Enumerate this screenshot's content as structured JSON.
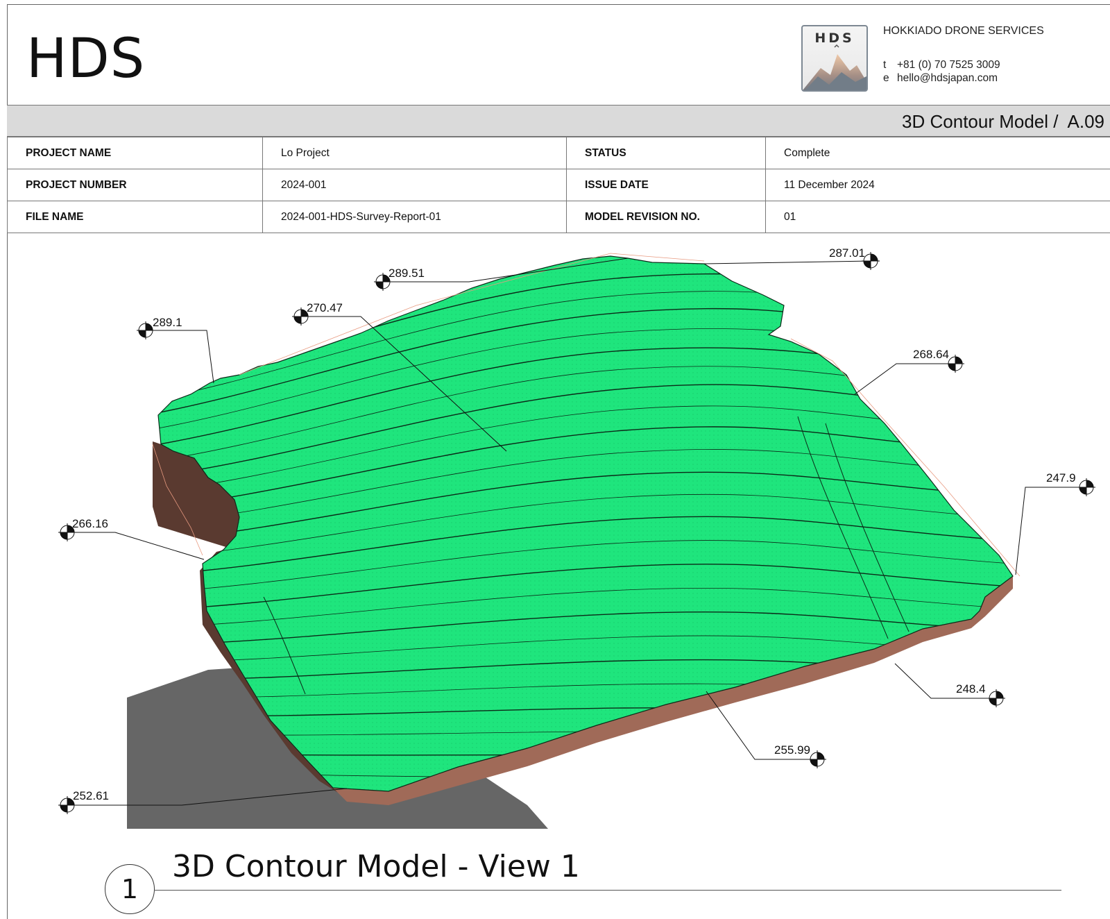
{
  "header": {
    "brand": "HDS",
    "logo_text": "HDS",
    "company": "HOKKIADO DRONE SERVICES",
    "phone_key": "t",
    "phone": "+81 (0) 70 7525 3009",
    "email_key": "e",
    "email": "hello@hdsjapan.com"
  },
  "sheet_title": "3D Contour Model /  A.09",
  "info": {
    "project_name_label": "PROJECT NAME",
    "project_name": "Lo Project",
    "status_label": "STATUS",
    "status": "Complete",
    "project_number_label": "PROJECT NUMBER",
    "project_number": "2024-001",
    "issue_date_label": "ISSUE DATE",
    "issue_date": "11 December 2024",
    "file_name_label": "FILE NAME",
    "file_name": "2024-001-HDS-Survey-Report-01",
    "revision_label": "MODEL REVISION NO.",
    "revision": "01"
  },
  "elevations": {
    "e1": "287.01",
    "e2": "289.51",
    "e3": "270.47",
    "e4": "289.1",
    "e5": "268.64",
    "e6": "247.9",
    "e7": "266.16",
    "e8": "248.4",
    "e9": "255.99",
    "e10": "252.61"
  },
  "view": {
    "number": "1",
    "title": "3D Contour Model - View 1"
  },
  "colors": {
    "terrain": "#1fe57d",
    "side": "#7a4e40",
    "shadow": "#666666",
    "titlebar": "#dadada"
  }
}
